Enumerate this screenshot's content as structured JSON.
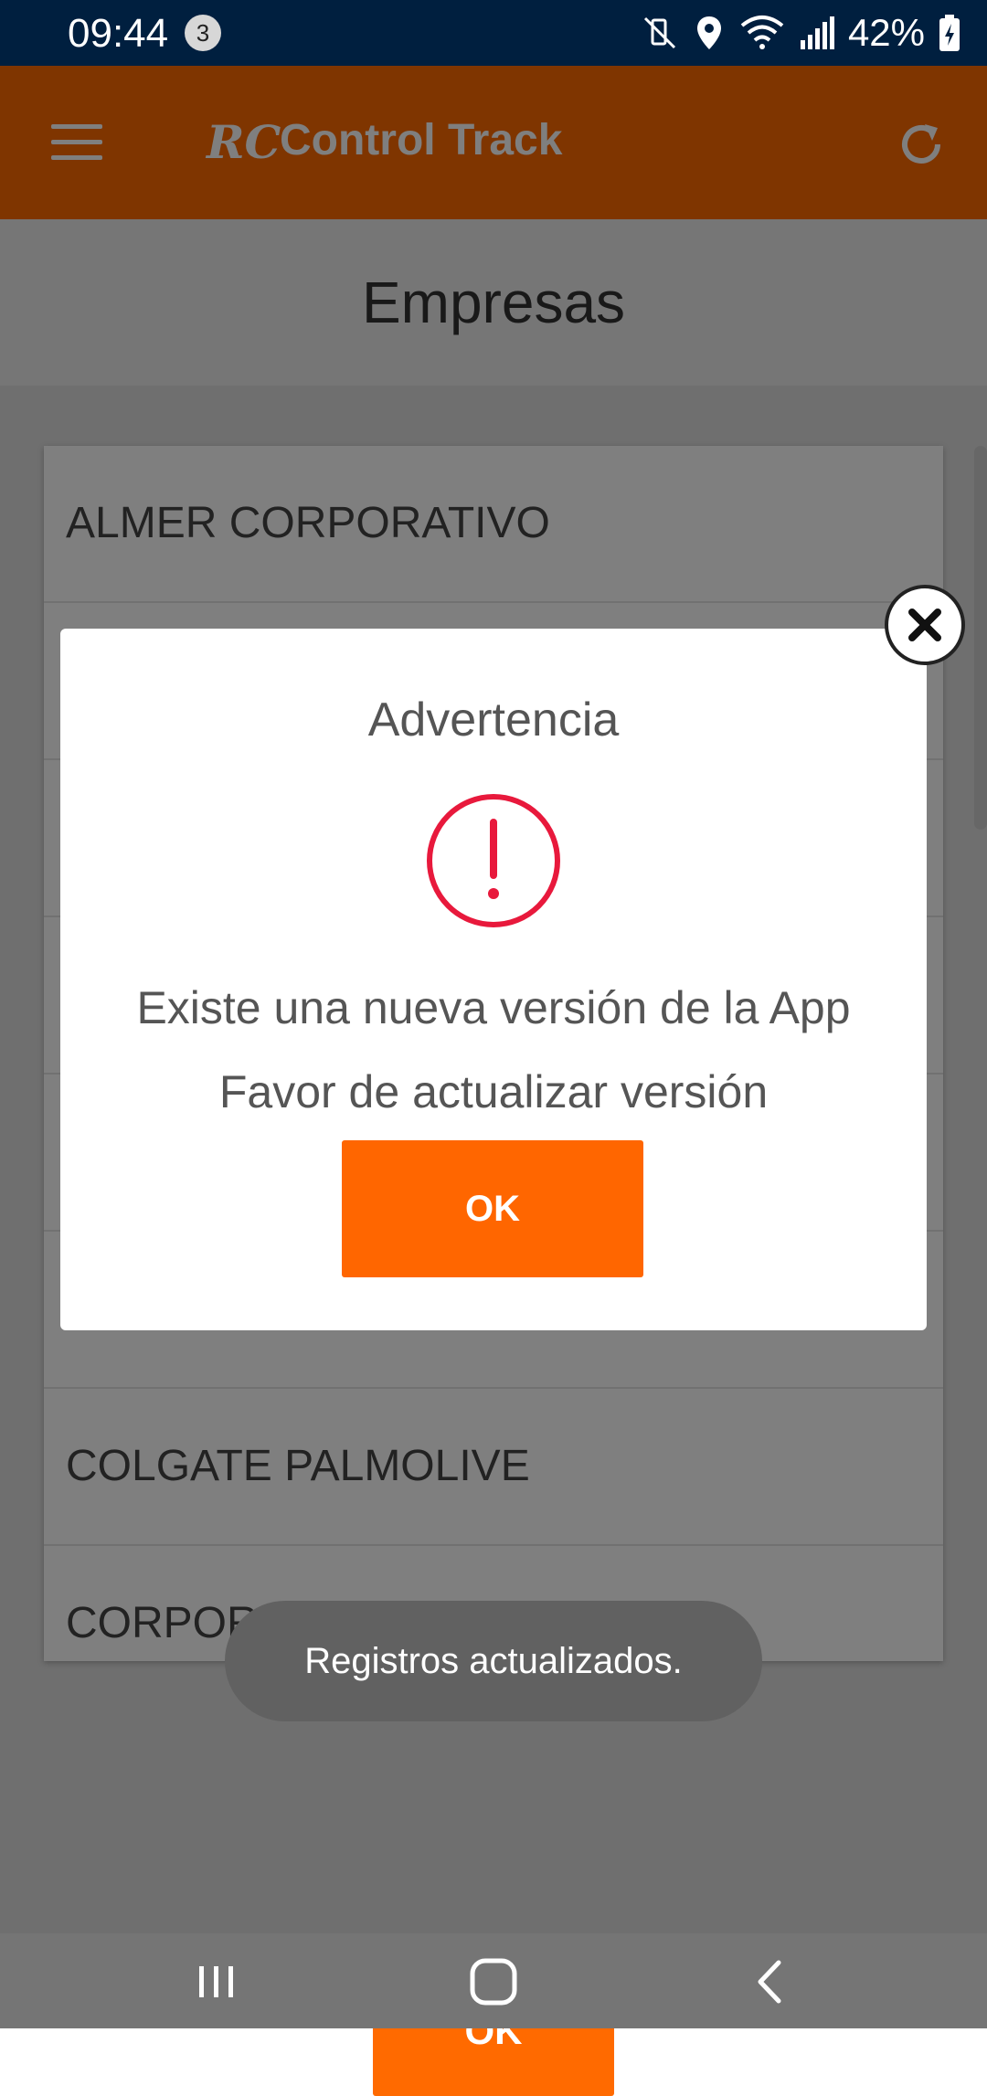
{
  "status_bar": {
    "time": "09:44",
    "notification_count": "3",
    "battery": "42%"
  },
  "app_bar": {
    "logo_mark": "RC",
    "app_title": "Control Track"
  },
  "page": {
    "title": "Empresas"
  },
  "companies": [
    "ALMER CORPORATIVO",
    "",
    "",
    "",
    "",
    "",
    "COLGATE PALMOLIVE",
    "CORPORATIVO ECOLAB"
  ],
  "bottom_button_label": "OK",
  "dialog": {
    "title": "Advertencia",
    "message_line1": "Existe una nueva versión de la App",
    "message_line2": "Favor de actualizar versión",
    "ok_label": "OK"
  },
  "toast": {
    "message": "Registros actualizados."
  },
  "colors": {
    "accent": "#ff6a00",
    "status_bar": "#001f3f",
    "alert_red": "#e8193c"
  }
}
